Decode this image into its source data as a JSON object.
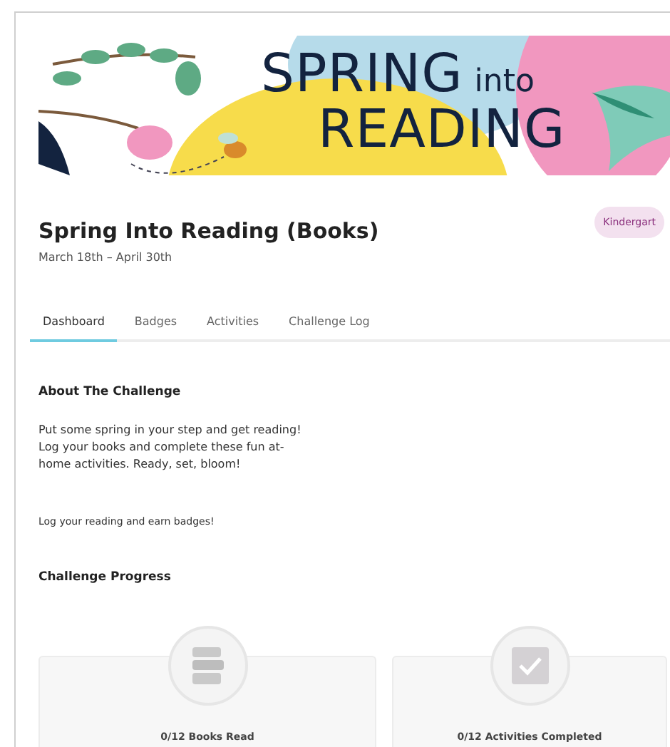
{
  "banner": {
    "word_1": "SPRING",
    "word_2": "into",
    "word_3": "READING"
  },
  "header": {
    "title": "Spring Into Reading (Books)",
    "dates": "March 18th – April 30th",
    "badge": "Kindergart"
  },
  "tabs": [
    {
      "label": "Dashboard",
      "selected": true
    },
    {
      "label": "Badges",
      "selected": false
    },
    {
      "label": "Activities",
      "selected": false
    },
    {
      "label": "Challenge Log",
      "selected": false
    }
  ],
  "about": {
    "heading": "About The Challenge",
    "description": "Put some spring in your step and get reading! Log your books and complete these fun at-home activities. Ready, set, bloom!",
    "note": "Log your reading and earn badges!"
  },
  "progress": {
    "heading": "Challenge Progress",
    "cards": [
      {
        "kind": "books",
        "label": "0/12 Books Read"
      },
      {
        "kind": "activities",
        "label": "0/12 Activities Completed"
      }
    ]
  }
}
